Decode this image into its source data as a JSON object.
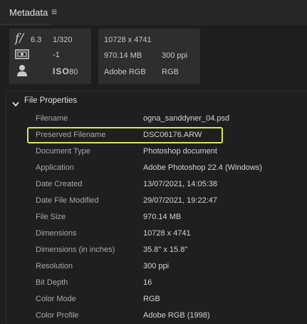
{
  "panel": {
    "title": "Metadata",
    "menu_icon": "hamburger-icon"
  },
  "camera_summary": {
    "aperture_symbol": "f/",
    "aperture": "6.3",
    "shutter": "1/320",
    "exposure_comp": "-1",
    "iso_label": "ISO",
    "iso": "80"
  },
  "file_summary": {
    "dimensions": "10728 x 4741",
    "size": "970.14 MB",
    "resolution": "300 ppi",
    "color_profile": "Adobe RGB",
    "color_mode": "RGB"
  },
  "section": {
    "title": "File Properties",
    "expanded": true,
    "rows": [
      {
        "label": "Filename",
        "value": "ogna_sanddyner_04.psd"
      },
      {
        "label": "Preserved Filename",
        "value": "DSC06176.ARW",
        "highlighted": true
      },
      {
        "label": "Document Type",
        "value": "Photoshop document"
      },
      {
        "label": "Application",
        "value": "Adobe Photoshop 22.4 (Windows)"
      },
      {
        "label": "Date Created",
        "value": "13/07/2021, 14:05:38"
      },
      {
        "label": "Date File Modified",
        "value": "29/07/2021, 19:22:47"
      },
      {
        "label": "File Size",
        "value": "970.14 MB"
      },
      {
        "label": "Dimensions",
        "value": "10728 x 4741"
      },
      {
        "label": "Dimensions (in inches)",
        "value": "35.8\" x 15.8\""
      },
      {
        "label": "Resolution",
        "value": "300 ppi"
      },
      {
        "label": "Bit Depth",
        "value": "16"
      },
      {
        "label": "Color Mode",
        "value": "RGB"
      },
      {
        "label": "Color Profile",
        "value": "Adobe RGB (1998)"
      }
    ]
  },
  "colors": {
    "highlight": "#d6e84c",
    "background": "#1e1e1e"
  }
}
